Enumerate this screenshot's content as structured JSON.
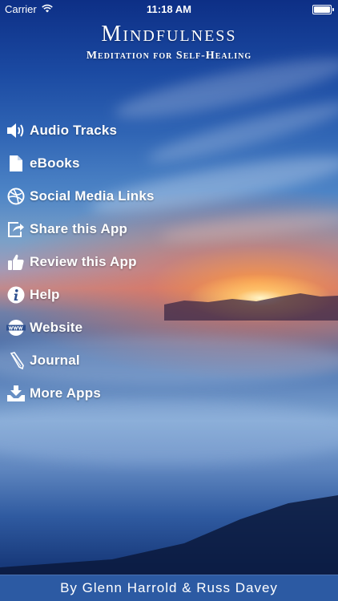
{
  "status_bar": {
    "carrier": "Carrier",
    "time": "11:18 AM"
  },
  "header": {
    "title": "Mindfulness",
    "subtitle": "Meditation for Self-Healing"
  },
  "menu": {
    "items": [
      {
        "label": "Audio Tracks",
        "icon": "speaker-icon"
      },
      {
        "label": "eBooks",
        "icon": "document-icon"
      },
      {
        "label": "Social Media Links",
        "icon": "dribbble-icon"
      },
      {
        "label": "Share this App",
        "icon": "share-icon"
      },
      {
        "label": "Review this App",
        "icon": "thumbs-up-icon"
      },
      {
        "label": "Help",
        "icon": "info-icon"
      },
      {
        "label": "Website",
        "icon": "www-globe-icon"
      },
      {
        "label": "Journal",
        "icon": "pencil-icon"
      },
      {
        "label": "More Apps",
        "icon": "download-tray-icon"
      }
    ]
  },
  "footer": {
    "credits": "By Glenn Harrold & Russ Davey"
  },
  "colors": {
    "footer_bg": "#2c5aa3",
    "text": "#ffffff"
  }
}
